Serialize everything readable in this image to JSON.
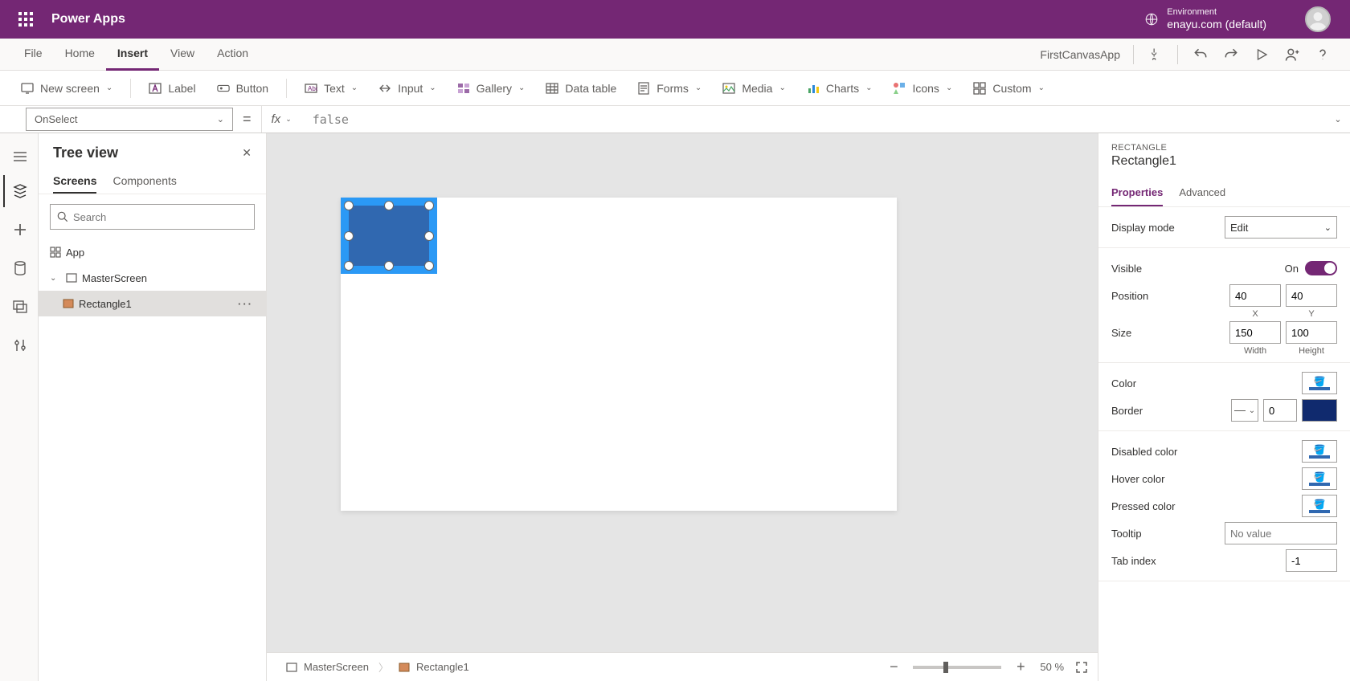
{
  "header": {
    "app_title": "Power Apps",
    "env_label": "Environment",
    "env_value": "enayu.com (default)"
  },
  "menu": {
    "items": [
      "File",
      "Home",
      "Insert",
      "View",
      "Action"
    ],
    "active_index": 2,
    "project_name": "FirstCanvasApp"
  },
  "ribbon": {
    "new_screen": "New screen",
    "label": "Label",
    "button": "Button",
    "text": "Text",
    "input": "Input",
    "gallery": "Gallery",
    "data_table": "Data table",
    "forms": "Forms",
    "media": "Media",
    "charts": "Charts",
    "icons": "Icons",
    "custom": "Custom"
  },
  "formula": {
    "property": "OnSelect",
    "fx": "fx",
    "value": "false"
  },
  "tree": {
    "title": "Tree view",
    "tabs": [
      "Screens",
      "Components"
    ],
    "active_tab": 0,
    "search_placeholder": "Search",
    "app_label": "App",
    "screen_label": "MasterScreen",
    "control_label": "Rectangle1"
  },
  "breadcrumb": {
    "screen": "MasterScreen",
    "control": "Rectangle1"
  },
  "zoom": {
    "percent": "50",
    "suffix": "%"
  },
  "props": {
    "type": "RECTANGLE",
    "name": "Rectangle1",
    "tabs": [
      "Properties",
      "Advanced"
    ],
    "active_tab": 0,
    "display_mode_label": "Display mode",
    "display_mode_value": "Edit",
    "visible_label": "Visible",
    "visible_state": "On",
    "position_label": "Position",
    "x": "40",
    "y": "40",
    "x_label": "X",
    "y_label": "Y",
    "size_label": "Size",
    "width": "150",
    "height": "100",
    "w_label": "Width",
    "h_label": "Height",
    "color_label": "Color",
    "border_label": "Border",
    "border_width": "0",
    "disabled_color_label": "Disabled color",
    "hover_color_label": "Hover color",
    "pressed_color_label": "Pressed color",
    "tooltip_label": "Tooltip",
    "tooltip_placeholder": "No value",
    "tabindex_label": "Tab index",
    "tabindex_value": "-1"
  }
}
